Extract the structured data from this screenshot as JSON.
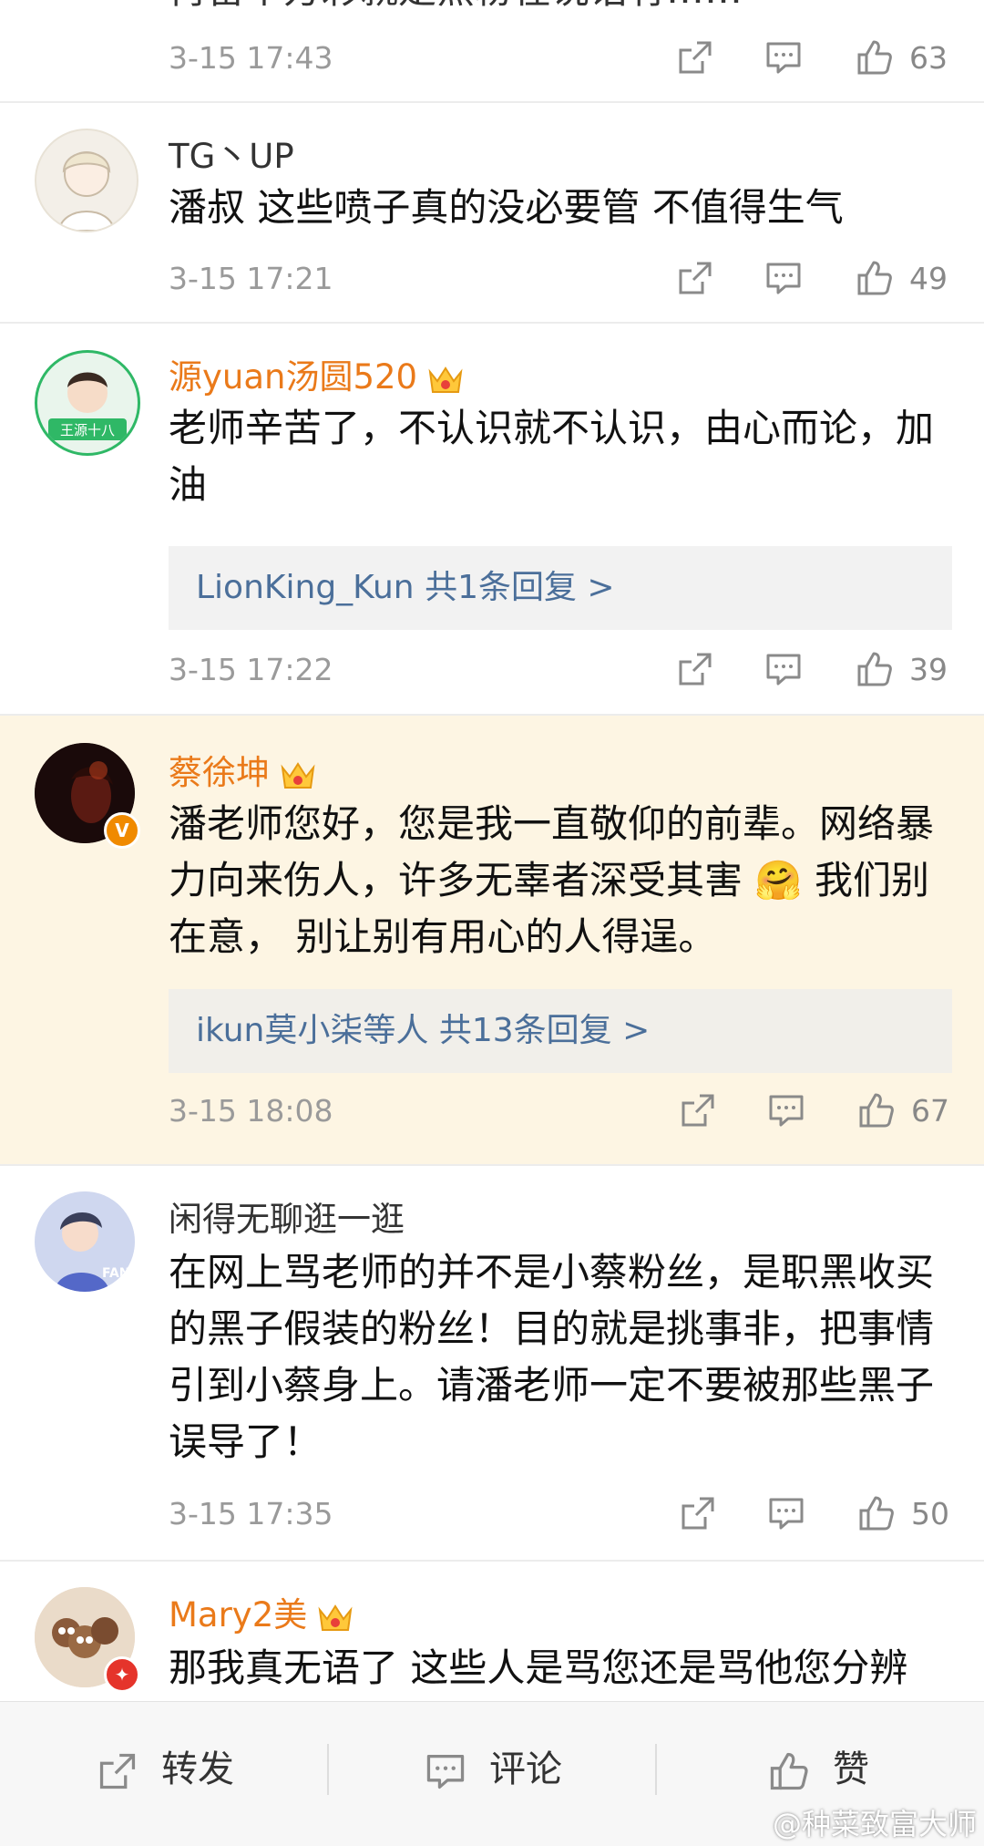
{
  "comments": [
    {
      "text": "再留个方彩就是黑粉在说话有……",
      "time": "3-15 17:43",
      "likes": "63"
    },
    {
      "user": "TG丶UP",
      "text": "潘叔 这些喷子真的没必要管 不值得生气",
      "time": "3-15 17:21",
      "likes": "49"
    },
    {
      "user": "源yuan汤圆520",
      "text": "老师辛苦了，不认识就不认识，由心而论，加油",
      "replies": "LionKing_Kun  共1条回复 >",
      "time": "3-15 17:22",
      "likes": "39",
      "avatar_text": "王源十八"
    },
    {
      "user": "蔡徐坤",
      "text": "潘老师您好，您是我一直敬仰的前辈。网络暴力向来伤人，许多无辜者深受其害 🤗 我们别在意， 别让别有用心的人得逞。",
      "replies": "ikun莫小柒等人  共13条回复 >",
      "time": "3-15 18:08",
      "likes": "67",
      "badge": "V"
    },
    {
      "user": "闲得无聊逛一逛",
      "text": "在网上骂老师的并不是小蔡粉丝，是职黑收买的黑子假装的粉丝！目的就是挑事非，把事情引到小蔡身上。请潘老师一定不要被那些黑子误导了！",
      "time": "3-15 17:35",
      "likes": "50",
      "avatar_text": "FAN"
    },
    {
      "user": "Mary2美",
      "text": "那我真无语了 这些人是骂您还是骂他您分辨"
    }
  ],
  "bottom_bar": {
    "repost": "转发",
    "comment": "评论",
    "like": "赞"
  },
  "watermark": "@种菜致富大师",
  "colors": {
    "highlight_bg": "#fdf5e3",
    "vip_name": "#ea7a1a",
    "reply_link": "#4b6f9a"
  },
  "icons": [
    "share-icon",
    "comment-icon",
    "like-icon",
    "crown-icon"
  ]
}
